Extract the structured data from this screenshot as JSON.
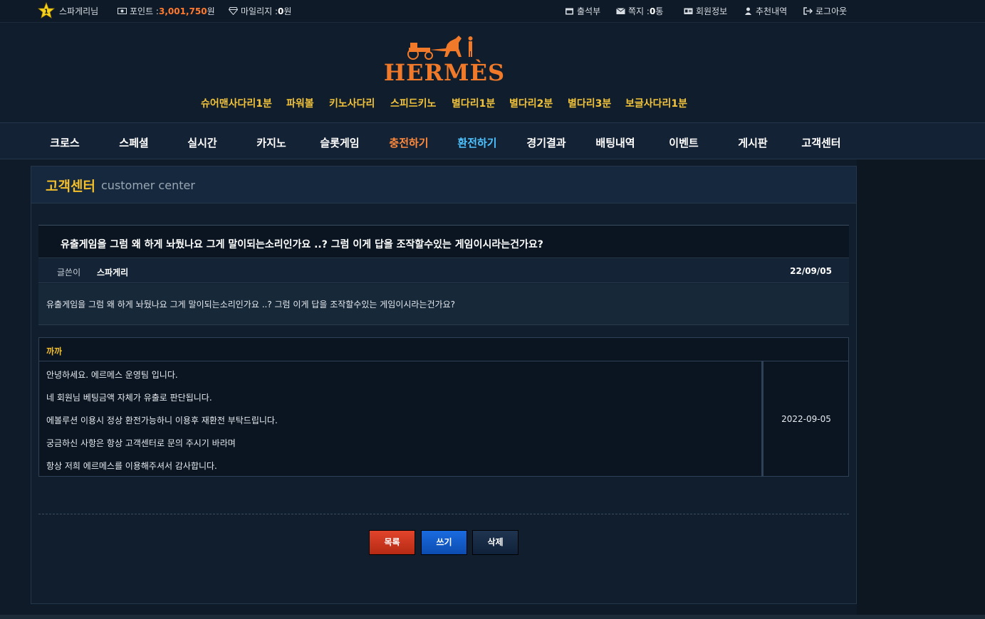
{
  "topbar": {
    "level": "1",
    "username": "스파게리님",
    "points_label": "포인트 : ",
    "points_value": "3,001,750",
    "points_unit": "원",
    "mileage_label": "마일리지 : ",
    "mileage_value": "0",
    "mileage_unit": "원",
    "attendance": "출석부",
    "messages_label": "쪽지 : ",
    "messages_value": "0",
    "messages_unit": " 통",
    "member_info": "회원정보",
    "referral": "추천내역",
    "logout": "로그아웃"
  },
  "brand": {
    "logo_text": "HERMÈS"
  },
  "subnav": [
    "슈어맨사다리1분",
    "파워볼",
    "키노사다리",
    "스피드키노",
    "별다리1분",
    "별다리2분",
    "별다리3분",
    "보글사다리1분"
  ],
  "mainnav": [
    "크로스",
    "스페셜",
    "실시간",
    "카지노",
    "슬롯게임",
    "충전하기",
    "환전하기",
    "경기결과",
    "배팅내역",
    "이벤트",
    "게시판",
    "고객센터"
  ],
  "colors": {
    "accent_orange": "#ff8a3c",
    "accent_blue": "#4dc3ff",
    "title_gold": "#f4bf29"
  },
  "panel": {
    "title": "고객센터",
    "subtitle": "customer center"
  },
  "post": {
    "title": "유출게임을 그럼 왜 하게 놔뒀나요 그게 말이되는소리인가요 ..? 그럼 이게 답을 조작할수있는 게임이시라는건가요?",
    "author_label": "글쓴이",
    "author": "스파게리",
    "date": "22/09/05",
    "body": "유출게임을 그럼 왜 하게 놔뒀나요 그게 말이되는소리인가요 ..? 그럼 이게 답을 조작할수있는 게임이시라는건가요?"
  },
  "reply": {
    "author": "까까",
    "lines": [
      "안녕하세요. 에르메스 운영팀 입니다.",
      "네 회원님 베팅금액 자체가 유출로 판단됩니다.",
      "에볼루션 이용시 정상 환전가능하니 이용후 재환전 부탁드립니다.",
      "궁금하신 사항은 항상 고객센터로 문의 주시기 바라며",
      "항상 저희 에르메스를 이용해주셔서 감사합니다."
    ],
    "date": "2022-09-05"
  },
  "buttons": {
    "list": "목록",
    "write": "쓰기",
    "delete": "삭제"
  }
}
